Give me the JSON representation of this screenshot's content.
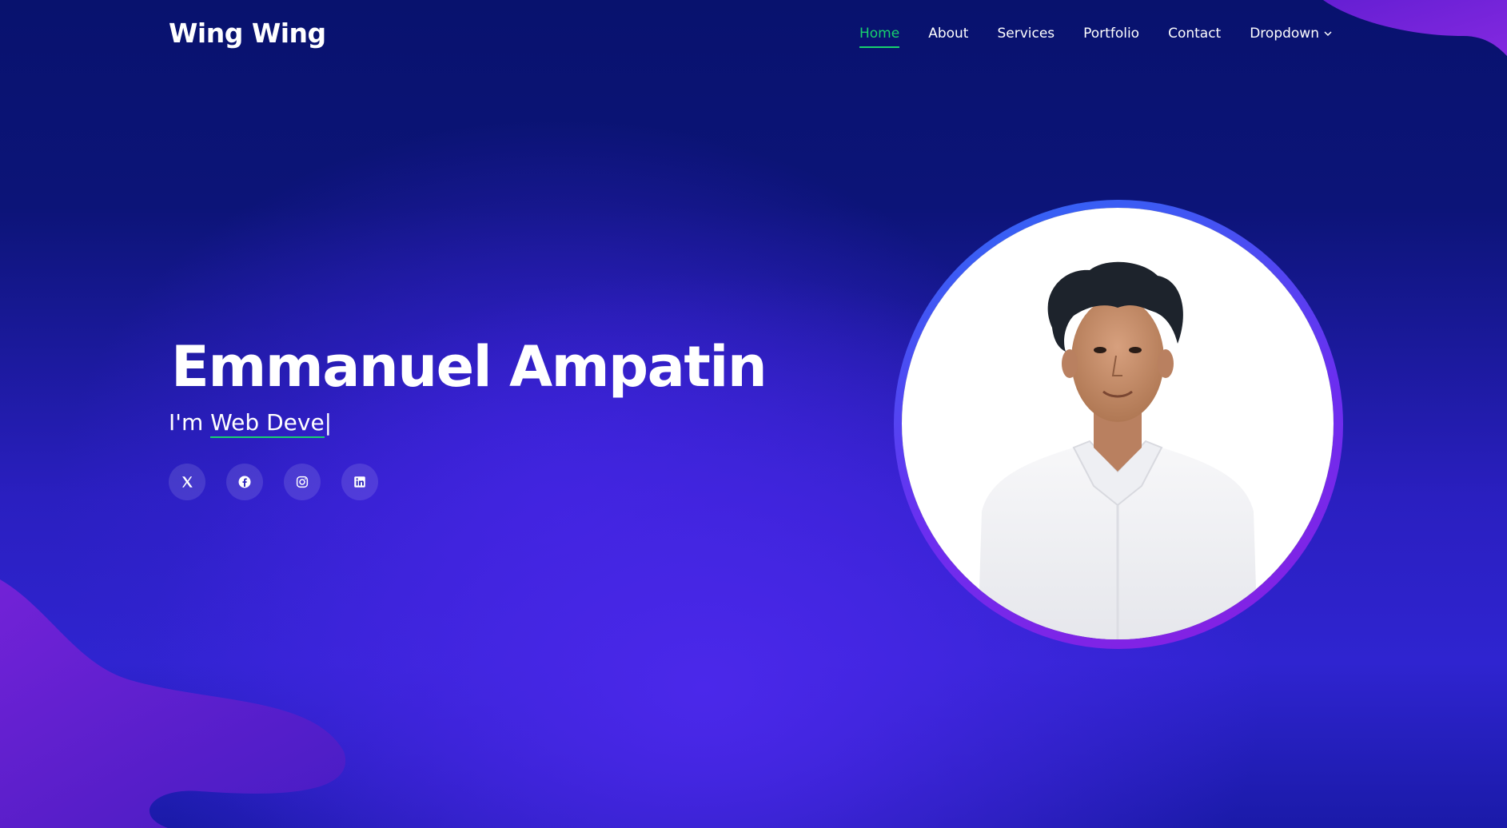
{
  "brand": {
    "logo_text": "Wing Wing"
  },
  "nav": {
    "items": [
      {
        "label": "Home",
        "active": true
      },
      {
        "label": "About"
      },
      {
        "label": "Services"
      },
      {
        "label": "Portfolio"
      },
      {
        "label": "Contact"
      },
      {
        "label": "Dropdown",
        "has_dropdown": true
      }
    ]
  },
  "hero": {
    "name": "Emmanuel Ampatin",
    "intro": "I'm",
    "typed_text": "Web Deve",
    "cursor": "|",
    "socials": [
      {
        "icon": "x-twitter-icon"
      },
      {
        "icon": "facebook-icon"
      },
      {
        "icon": "instagram-icon"
      },
      {
        "icon": "linkedin-icon"
      }
    ]
  },
  "profile": {
    "image": "profile-photo"
  },
  "colors": {
    "accent": "#18d26e",
    "background_top": "#08126e",
    "background_glow": "#4b28ea",
    "ring_start": "#2a6cf6",
    "ring_end": "#8a1ee0",
    "wave": "#6a1fd8"
  }
}
